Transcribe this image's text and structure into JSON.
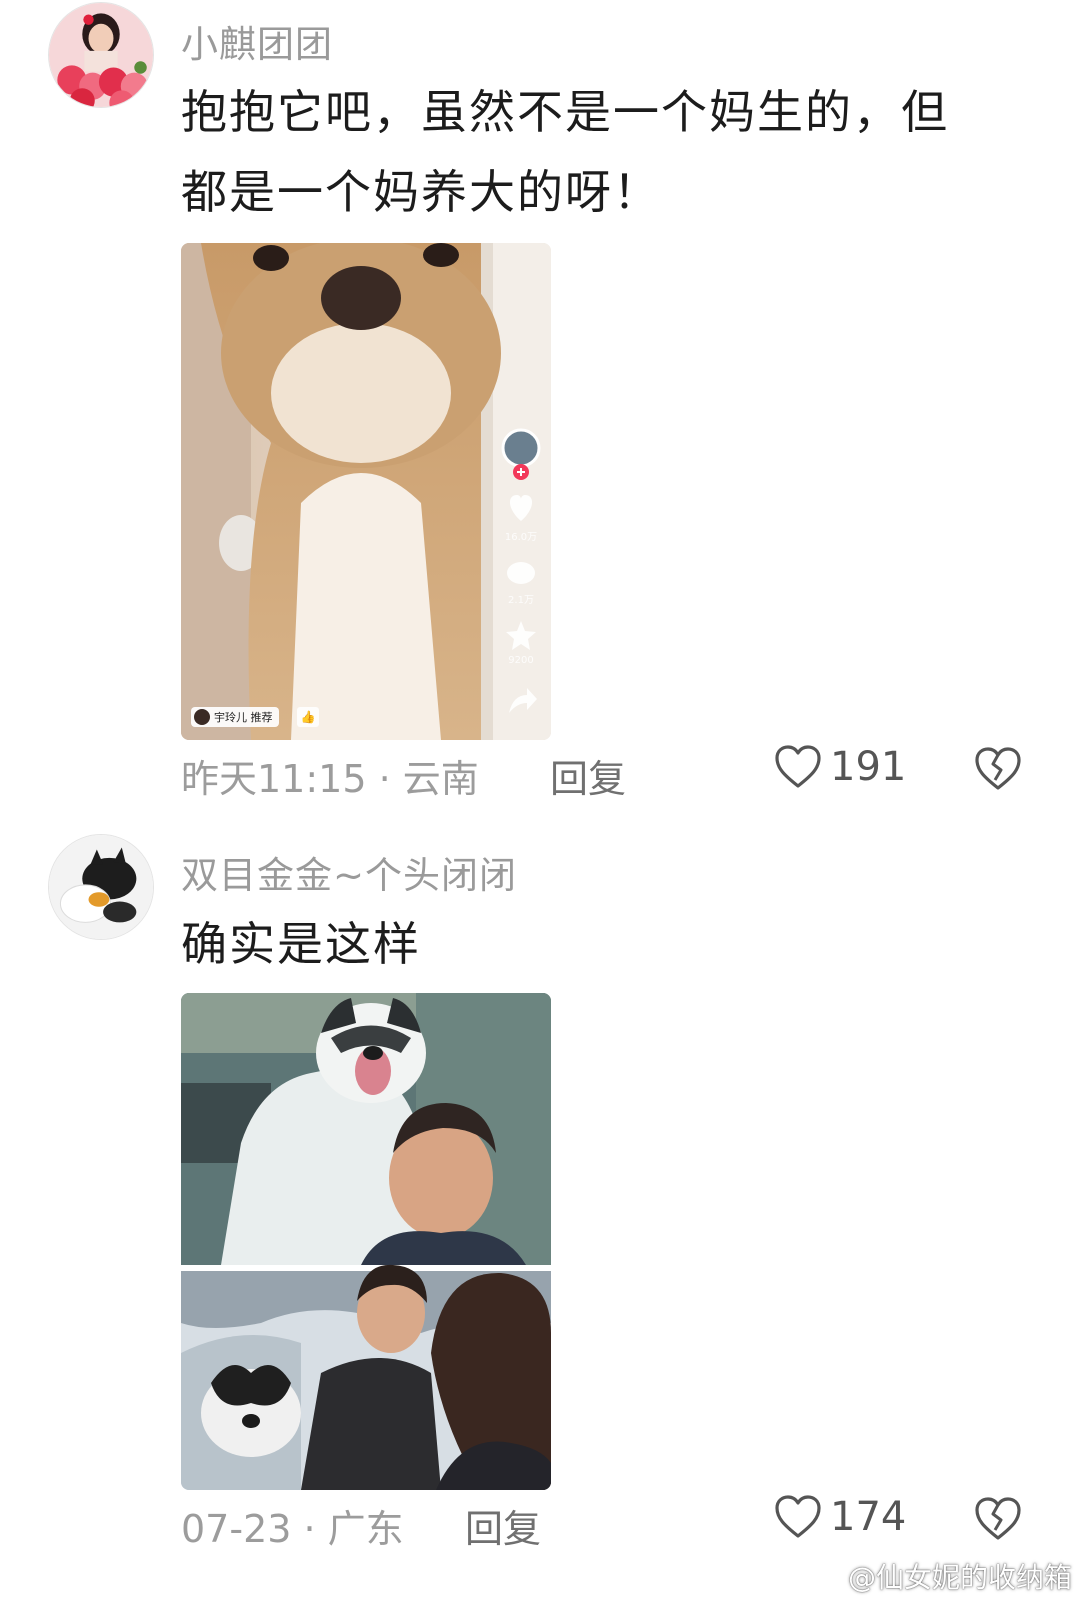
{
  "comments": [
    {
      "username": "小麒团团",
      "text_line1": "抱抱它吧，虽然不是一个妈生的，但",
      "text_line2": "都是一个妈养大的呀！",
      "video_overlay": {
        "recommend_label": "宇玲儿 推荐",
        "like_count": "16.0万",
        "comment_count": "2.1万",
        "favorite_count": "9200"
      },
      "time": "昨天11:15",
      "location": "云南",
      "reply_label": "回复",
      "likes": "191"
    },
    {
      "username": "双目金金~个头闭闭",
      "text_line1": "确实是这样",
      "time": "07-23",
      "location": "广东",
      "reply_label": "回复",
      "likes": "174"
    }
  ],
  "meta_separator": " · ",
  "watermark": "@仙女妮的收纳箱",
  "colors": {
    "username": "#9a9a9a",
    "text": "#1c1c1c",
    "meta": "#9c9c9c",
    "follow_badge": "#f2385a"
  }
}
